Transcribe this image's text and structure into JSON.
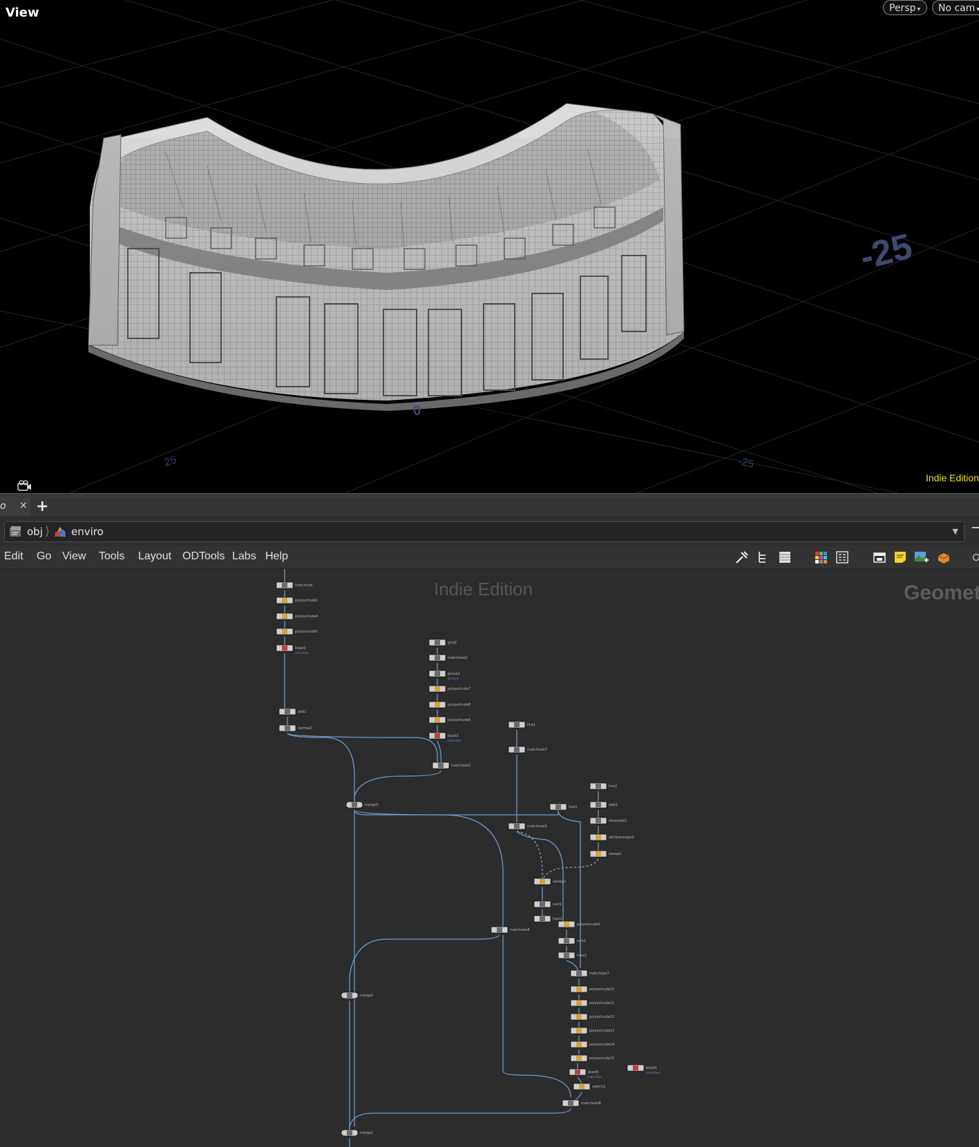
{
  "viewport": {
    "title": "View",
    "camera_mode": "Persp",
    "camera_select": "No cam",
    "edition_label": "Indie Edition",
    "grid_labels": {
      "far_right": "-25",
      "center": "0",
      "left": "25",
      "right": "-25"
    }
  },
  "tabs": [
    {
      "label": "o",
      "close": "×"
    }
  ],
  "tab_add": "+",
  "path": {
    "root": "obj",
    "current": "enviro"
  },
  "menu": [
    "Edit",
    "Go",
    "View",
    "Tools",
    "Layout",
    "ODTools",
    "Labs",
    "Help"
  ],
  "toolbar_icons": [
    "wrench-icon",
    "tree-view-icon",
    "list-view-icon",
    "color-palette-icon",
    "shape-palette-icon",
    "network-box-icon",
    "sticky-note-icon",
    "background-image-icon",
    "dependency-icon",
    "options-icon"
  ],
  "network": {
    "watermark": "Indie Edition",
    "context_label": "Geomet",
    "nodes": [
      {
        "name": "matchsize"
      },
      {
        "name": "polyextrude1"
      },
      {
        "name": "polyextrude4"
      },
      {
        "name": "polyextrude5"
      },
      {
        "name": "blast2"
      },
      {
        "name": "add1"
      },
      {
        "name": "normal2"
      },
      {
        "name": "grid2"
      },
      {
        "name": "matchsize2"
      },
      {
        "name": "group1"
      },
      {
        "name": "polyextrude7"
      },
      {
        "name": "polyextrude8"
      },
      {
        "name": "polyextrude6"
      },
      {
        "name": "blast3"
      },
      {
        "name": "matchsize1"
      },
      {
        "name": "merge3"
      },
      {
        "name": "line1"
      },
      {
        "name": "matchsize3"
      },
      {
        "name": "line2"
      },
      {
        "name": "add2"
      },
      {
        "name": "resample1"
      },
      {
        "name": "attribwrangle2"
      },
      {
        "name": "sweep1"
      },
      {
        "name": "line3"
      },
      {
        "name": "matchsize5"
      },
      {
        "name": "sweep2"
      },
      {
        "name": "sort1"
      },
      {
        "name": "fuse1"
      },
      {
        "name": "matchsize6"
      },
      {
        "name": "polyextrude9"
      },
      {
        "name": "sort2"
      },
      {
        "name": "fuse2"
      },
      {
        "name": "matchsize7"
      },
      {
        "name": "polyextrude10"
      },
      {
        "name": "polyextrude11"
      },
      {
        "name": "polyextrude12"
      },
      {
        "name": "polyextrude13"
      },
      {
        "name": "polyextrude14"
      },
      {
        "name": "polyextrude15"
      },
      {
        "name": "blast5"
      },
      {
        "name": "switch1"
      },
      {
        "name": "matchsize8"
      },
      {
        "name": "merge2"
      },
      {
        "name": "merge1"
      },
      {
        "name": "blast4"
      }
    ],
    "node_flags": {
      "blast2": "selection",
      "blast3": "selection",
      "blast5": "selection",
      "blast4": "selection",
      "group1": "group1"
    }
  }
}
